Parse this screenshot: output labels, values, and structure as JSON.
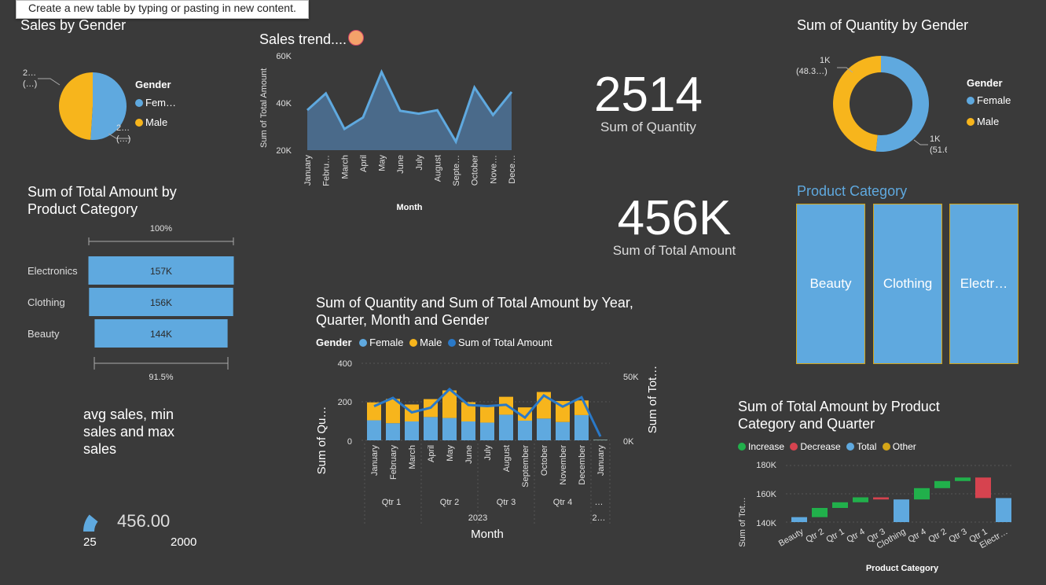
{
  "tooltip": "Create a new table by typing or pasting in new content.",
  "colors": {
    "female": "#5fa9df",
    "male": "#f7b51c",
    "total_line": "#2a79c8",
    "increase": "#21b04b",
    "decrease": "#d6434f",
    "other": "#d4a517",
    "bg": "#3a3a3a"
  },
  "sales_by_gender": {
    "title": "Sales by Gender",
    "legend_title": "Gender",
    "legend": [
      "Fem…",
      "Male"
    ],
    "label_top": [
      "2…",
      "(…)"
    ],
    "label_bottom": [
      "2…",
      "(…)"
    ],
    "chart_data": {
      "type": "pie",
      "categories": [
        "Female",
        "Male"
      ],
      "values": [
        51,
        49
      ]
    }
  },
  "sales_trend": {
    "title": "Sales trend....",
    "ylabel": "Sum of Total Amount",
    "xlabel": "Month",
    "yticks": [
      "60K",
      "40K",
      "20K"
    ],
    "chart_data": {
      "type": "area",
      "categories": [
        "January",
        "Febru…",
        "March",
        "April",
        "May",
        "June",
        "July",
        "August",
        "Septe…",
        "October",
        "Nove…",
        "Dece…"
      ],
      "values": [
        36980,
        44060,
        28990,
        33870,
        53150,
        36715,
        35465,
        36960,
        23620,
        46580,
        34920,
        44690
      ],
      "ylim": [
        20000,
        60000
      ]
    }
  },
  "kpi_quantity": {
    "value": "2514",
    "label": "Sum of Quantity"
  },
  "kpi_amount": {
    "value": "456K",
    "label": "Sum of Total Amount"
  },
  "qty_by_gender": {
    "title": "Sum of Quantity by Gender",
    "legend_title": "Gender",
    "legend": [
      "Female",
      "Male"
    ],
    "label_male": [
      "1K",
      "(48.3…)"
    ],
    "label_female": [
      "1K",
      "(51.6…)"
    ],
    "chart_data": {
      "type": "pie",
      "categories": [
        "Female",
        "Male"
      ],
      "values": [
        51.6,
        48.3
      ]
    }
  },
  "product_category": {
    "title": "Product Category",
    "tiles": [
      "Beauty",
      "Clothing",
      "Electr…"
    ]
  },
  "funnel": {
    "title": [
      "Sum of Total Amount by",
      "Product Category"
    ],
    "top_pct": "100%",
    "bottom_pct": "91.5%",
    "chart_data": {
      "type": "bar",
      "categories": [
        "Electronics",
        "Clothing",
        "Beauty"
      ],
      "labels": [
        "157K",
        "156K",
        "144K"
      ],
      "values": [
        156905,
        155580,
        143515
      ]
    }
  },
  "stats_title": [
    "avg sales, min",
    "sales and max",
    "sales"
  ],
  "gauge": {
    "value": "456.00",
    "min": "25",
    "max": "2000",
    "chart_data": {
      "type": "gauge",
      "value": 456,
      "min": 25,
      "max": 2000
    }
  },
  "combo": {
    "title": [
      "Sum of Quantity and Sum of Total Amount by Year,",
      "Quarter, Month and Gender"
    ],
    "legend_title": "Gender",
    "legend": [
      "Female",
      "Male",
      "Sum of Total Amount"
    ],
    "ylabel_left": "Sum of Qu…",
    "ylabel_right": "Sum of Tot…",
    "yticks_left": [
      "400",
      "200",
      "0"
    ],
    "yticks_right": [
      "50K",
      "0K"
    ],
    "xlabel": "Month",
    "quarters": [
      "Qtr 1",
      "Qtr 2",
      "Qtr 3",
      "Qtr 4",
      "…"
    ],
    "years": [
      "2023",
      "2…"
    ],
    "chart_data": {
      "type": "bar",
      "categories": [
        "January",
        "February",
        "March",
        "April",
        "May",
        "June",
        "July",
        "August",
        "September",
        "October",
        "November",
        "December",
        "January"
      ],
      "series": [
        {
          "name": "Female",
          "values": [
            104,
            89,
            98,
            121,
            116,
            98,
            92,
            133,
            102,
            113,
            95,
            131,
            3
          ]
        },
        {
          "name": "Male",
          "values": [
            93,
            126,
            88,
            93,
            143,
            100,
            86,
            93,
            69,
            138,
            109,
            76,
            1
          ]
        },
        {
          "name": "Sum of Total Amount",
          "values": [
            35450,
            44060,
            28990,
            33870,
            53150,
            36715,
            35465,
            36960,
            23620,
            46580,
            34920,
            44690,
            4000
          ]
        }
      ],
      "ylim_left": [
        0,
        400
      ],
      "ylim_right": [
        0,
        80000
      ]
    }
  },
  "waterfall": {
    "title": [
      "Sum of Total Amount by Product",
      "Category and Quarter"
    ],
    "legend": [
      "Increase",
      "Decrease",
      "Total",
      "Other"
    ],
    "ylabel": "Sum of Tot…",
    "xlabel": "Product Category",
    "yticks": [
      "180K",
      "160K",
      "140K"
    ],
    "chart_data": {
      "type": "waterfall",
      "categories": [
        "Beauty",
        "Qtr 2",
        "Qtr 1",
        "Qtr 4",
        "Qtr 3",
        "Clothing",
        "Qtr 4",
        "Qtr 2",
        "Qtr 3",
        "Qtr 1",
        "Electr…"
      ],
      "bars": [
        {
          "start": 140000,
          "end": 143500,
          "kind": "total"
        },
        {
          "start": 143500,
          "end": 150000,
          "kind": "increase"
        },
        {
          "start": 150000,
          "end": 154000,
          "kind": "increase"
        },
        {
          "start": 154000,
          "end": 157500,
          "kind": "increase"
        },
        {
          "start": 157500,
          "end": 156000,
          "kind": "decrease"
        },
        {
          "start": 140000,
          "end": 156000,
          "kind": "total"
        },
        {
          "start": 156000,
          "end": 164000,
          "kind": "increase"
        },
        {
          "start": 164000,
          "end": 169000,
          "kind": "increase"
        },
        {
          "start": 169000,
          "end": 171500,
          "kind": "increase"
        },
        {
          "start": 171500,
          "end": 157000,
          "kind": "decrease"
        },
        {
          "start": 140000,
          "end": 157000,
          "kind": "total"
        }
      ],
      "ylim": [
        135000,
        185000
      ]
    }
  }
}
